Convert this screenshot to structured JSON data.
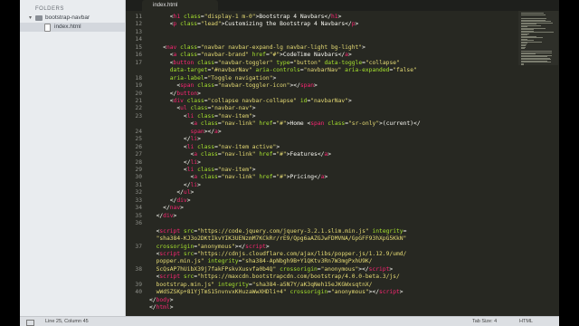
{
  "sidebar": {
    "title": "FOLDERS",
    "folder": "bootstrap-navbar",
    "file": "index.html"
  },
  "tab": {
    "label": "index.html"
  },
  "status": {
    "position": "Line 25, Column 45",
    "tab_size": "Tab Size: 4",
    "syntax": "HTML"
  },
  "line_numbers": [
    "11",
    "12",
    "13",
    "14",
    "15",
    "16",
    "17",
    "",
    "18",
    "19",
    "20",
    "21",
    "22",
    "23",
    "",
    "24",
    "25",
    "26",
    "27",
    "28",
    "29",
    "30",
    "31",
    "32",
    "33",
    "34",
    "35",
    "36",
    "",
    "",
    "37",
    "",
    "",
    "38",
    "",
    "39",
    "40"
  ],
  "code_lines": [
    [
      [
        "pl",
        "      <"
      ],
      [
        "tg",
        "h1"
      ],
      [
        "pl",
        " "
      ],
      [
        "at",
        "class"
      ],
      [
        "pl",
        "="
      ],
      [
        "st",
        "\"display-1 m-0\""
      ],
      [
        "pl",
        ">Bootstrap 4 Navbars</"
      ],
      [
        "tg",
        "h1"
      ],
      [
        "pl",
        ">"
      ]
    ],
    [
      [
        "pl",
        "      <"
      ],
      [
        "tg",
        "p"
      ],
      [
        "pl",
        " "
      ],
      [
        "at",
        "class"
      ],
      [
        "pl",
        "="
      ],
      [
        "st",
        "\"lead\""
      ],
      [
        "pl",
        ">Customizing the Bootstrap 4 Navbars</"
      ],
      [
        "tg",
        "p"
      ],
      [
        "pl",
        ">"
      ]
    ],
    [],
    [],
    [
      [
        "pl",
        "    <"
      ],
      [
        "tg",
        "nav"
      ],
      [
        "pl",
        " "
      ],
      [
        "at",
        "class"
      ],
      [
        "pl",
        "="
      ],
      [
        "st",
        "\"navbar navbar-expand-lg navbar-light bg-light\""
      ],
      [
        "pl",
        ">"
      ]
    ],
    [
      [
        "pl",
        "      <"
      ],
      [
        "tg",
        "a"
      ],
      [
        "pl",
        " "
      ],
      [
        "at",
        "class"
      ],
      [
        "pl",
        "="
      ],
      [
        "st",
        "\"navbar-brand\""
      ],
      [
        "pl",
        " "
      ],
      [
        "at",
        "href"
      ],
      [
        "pl",
        "="
      ],
      [
        "st",
        "\"#\""
      ],
      [
        "pl",
        ">CodeTime Navbars</"
      ],
      [
        "tg",
        "a"
      ],
      [
        "pl",
        ">"
      ]
    ],
    [
      [
        "pl",
        "      <"
      ],
      [
        "tg",
        "button"
      ],
      [
        "pl",
        " "
      ],
      [
        "at",
        "class"
      ],
      [
        "pl",
        "="
      ],
      [
        "st",
        "\"navbar-toggler\""
      ],
      [
        "pl",
        " "
      ],
      [
        "at",
        "type"
      ],
      [
        "pl",
        "="
      ],
      [
        "st",
        "\"button\""
      ],
      [
        "pl",
        " "
      ],
      [
        "at",
        "data-toggle"
      ],
      [
        "pl",
        "="
      ],
      [
        "st",
        "\"collapse\""
      ]
    ],
    [
      [
        "pl",
        "      "
      ],
      [
        "at",
        "data-target"
      ],
      [
        "pl",
        "="
      ],
      [
        "st",
        "\"#navbarNav\""
      ],
      [
        "pl",
        " "
      ],
      [
        "at",
        "aria-controls"
      ],
      [
        "pl",
        "="
      ],
      [
        "st",
        "\"navbarNav\""
      ],
      [
        "pl",
        " "
      ],
      [
        "at",
        "aria-expanded"
      ],
      [
        "pl",
        "="
      ],
      [
        "st",
        "\"false\""
      ]
    ],
    [
      [
        "pl",
        "      "
      ],
      [
        "at",
        "aria-label"
      ],
      [
        "pl",
        "="
      ],
      [
        "st",
        "\"Toggle navigation\""
      ],
      [
        "pl",
        ">"
      ]
    ],
    [
      [
        "pl",
        "        <"
      ],
      [
        "tg",
        "span"
      ],
      [
        "pl",
        " "
      ],
      [
        "at",
        "class"
      ],
      [
        "pl",
        "="
      ],
      [
        "st",
        "\"navbar-toggler-icon\""
      ],
      [
        "pl",
        "></"
      ],
      [
        "tg",
        "span"
      ],
      [
        "pl",
        ">"
      ]
    ],
    [
      [
        "pl",
        "      </"
      ],
      [
        "tg",
        "button"
      ],
      [
        "pl",
        ">"
      ]
    ],
    [
      [
        "pl",
        "      <"
      ],
      [
        "tg",
        "div"
      ],
      [
        "pl",
        " "
      ],
      [
        "at",
        "class"
      ],
      [
        "pl",
        "="
      ],
      [
        "st",
        "\"collapse navbar-collapse\""
      ],
      [
        "pl",
        " "
      ],
      [
        "at",
        "id"
      ],
      [
        "pl",
        "="
      ],
      [
        "st",
        "\"navbarNav\""
      ],
      [
        "pl",
        ">"
      ]
    ],
    [
      [
        "pl",
        "        <"
      ],
      [
        "tg",
        "ul"
      ],
      [
        "pl",
        " "
      ],
      [
        "at",
        "class"
      ],
      [
        "pl",
        "="
      ],
      [
        "st",
        "\"navbar-nav\""
      ],
      [
        "pl",
        ">"
      ]
    ],
    [
      [
        "pl",
        "          <"
      ],
      [
        "tg",
        "li"
      ],
      [
        "pl",
        " "
      ],
      [
        "at",
        "class"
      ],
      [
        "pl",
        "="
      ],
      [
        "st",
        "\"nav-item\""
      ],
      [
        "pl",
        ">"
      ]
    ],
    [
      [
        "pl",
        "            <"
      ],
      [
        "tg",
        "a"
      ],
      [
        "pl",
        " "
      ],
      [
        "at",
        "class"
      ],
      [
        "pl",
        "="
      ],
      [
        "st",
        "\"nav-link\""
      ],
      [
        "pl",
        " "
      ],
      [
        "at",
        "href"
      ],
      [
        "pl",
        "="
      ],
      [
        "st",
        "\"#\""
      ],
      [
        "pl",
        ">Home <"
      ],
      [
        "tg",
        "span"
      ],
      [
        "pl",
        " "
      ],
      [
        "at",
        "class"
      ],
      [
        "pl",
        "="
      ],
      [
        "st",
        "\"sr-only\""
      ],
      [
        "pl",
        ">(current)</"
      ]
    ],
    [
      [
        "pl",
        "            "
      ],
      [
        "tg",
        "span"
      ],
      [
        "pl",
        "></"
      ],
      [
        "tg",
        "a"
      ],
      [
        "pl",
        ">"
      ]
    ],
    [
      [
        "pl",
        "          </"
      ],
      [
        "tg",
        "li"
      ],
      [
        "pl",
        ">"
      ]
    ],
    [
      [
        "pl",
        "          <"
      ],
      [
        "tg",
        "li"
      ],
      [
        "pl",
        " "
      ],
      [
        "at",
        "class"
      ],
      [
        "pl",
        "="
      ],
      [
        "st",
        "\"nav-item active\""
      ],
      [
        "pl",
        ">"
      ]
    ],
    [
      [
        "pl",
        "            <"
      ],
      [
        "tg",
        "a"
      ],
      [
        "pl",
        " "
      ],
      [
        "at",
        "class"
      ],
      [
        "pl",
        "="
      ],
      [
        "st",
        "\"nav-link\""
      ],
      [
        "pl",
        " "
      ],
      [
        "at",
        "href"
      ],
      [
        "pl",
        "="
      ],
      [
        "st",
        "\"#\""
      ],
      [
        "pl",
        ">Features</"
      ],
      [
        "tg",
        "a"
      ],
      [
        "pl",
        ">"
      ]
    ],
    [
      [
        "pl",
        "          </"
      ],
      [
        "tg",
        "li"
      ],
      [
        "pl",
        ">"
      ]
    ],
    [
      [
        "pl",
        "          <"
      ],
      [
        "tg",
        "li"
      ],
      [
        "pl",
        " "
      ],
      [
        "at",
        "class"
      ],
      [
        "pl",
        "="
      ],
      [
        "st",
        "\"nav-item\""
      ],
      [
        "pl",
        ">"
      ]
    ],
    [
      [
        "pl",
        "            <"
      ],
      [
        "tg",
        "a"
      ],
      [
        "pl",
        " "
      ],
      [
        "at",
        "class"
      ],
      [
        "pl",
        "="
      ],
      [
        "st",
        "\"nav-link\""
      ],
      [
        "pl",
        " "
      ],
      [
        "at",
        "href"
      ],
      [
        "pl",
        "="
      ],
      [
        "st",
        "\"#\""
      ],
      [
        "pl",
        ">Pricing</"
      ],
      [
        "tg",
        "a"
      ],
      [
        "pl",
        ">"
      ]
    ],
    [
      [
        "pl",
        "          </"
      ],
      [
        "tg",
        "li"
      ],
      [
        "pl",
        ">"
      ]
    ],
    [
      [
        "pl",
        "        </"
      ],
      [
        "tg",
        "ul"
      ],
      [
        "pl",
        ">"
      ]
    ],
    [
      [
        "pl",
        "      </"
      ],
      [
        "tg",
        "div"
      ],
      [
        "pl",
        ">"
      ]
    ],
    [
      [
        "pl",
        "    </"
      ],
      [
        "tg",
        "nav"
      ],
      [
        "pl",
        ">"
      ]
    ],
    [
      [
        "pl",
        "  </"
      ],
      [
        "tg",
        "div"
      ],
      [
        "pl",
        ">"
      ]
    ],
    [],
    [
      [
        "pl",
        "  <"
      ],
      [
        "tg",
        "script"
      ],
      [
        "pl",
        " "
      ],
      [
        "at",
        "src"
      ],
      [
        "pl",
        "="
      ],
      [
        "st",
        "\"https://code.jquery.com/jquery-3.2.1.slim.min.js\""
      ],
      [
        "pl",
        " "
      ],
      [
        "at",
        "integrity"
      ],
      [
        "pl",
        "="
      ]
    ],
    [
      [
        "st",
        "  \"sha384-KJ3o2DKtIkvYIK3UENzmM7KCkRr/rE9/Qpg6aAZGJwFDMVNA/GpGFF93hXpG5KkN\""
      ]
    ],
    [
      [
        "pl",
        "  "
      ],
      [
        "at",
        "crossorigin"
      ],
      [
        "pl",
        "="
      ],
      [
        "st",
        "\"anonymous\""
      ],
      [
        "pl",
        "></"
      ],
      [
        "tg",
        "script"
      ],
      [
        "pl",
        ">"
      ]
    ],
    [
      [
        "pl",
        "  <"
      ],
      [
        "tg",
        "script"
      ],
      [
        "pl",
        " "
      ],
      [
        "at",
        "src"
      ],
      [
        "pl",
        "="
      ],
      [
        "st",
        "\"https://cdnjs.cloudflare.com/ajax/libs/popper.js/1.12.9/umd/"
      ]
    ],
    [
      [
        "st",
        "  popper.min.js\""
      ],
      [
        "pl",
        " "
      ],
      [
        "at",
        "integrity"
      ],
      [
        "pl",
        "="
      ],
      [
        "st",
        "\"sha384-ApNbgh9B+Y1QKtv3Rn7W3mgPxhU9K/"
      ]
    ],
    [
      [
        "st",
        "  ScQsAP7hUibX39j7fakFPskvXusvfa0b4Q\""
      ],
      [
        "pl",
        " "
      ],
      [
        "at",
        "crossorigin"
      ],
      [
        "pl",
        "="
      ],
      [
        "st",
        "\"anonymous\""
      ],
      [
        "pl",
        "></"
      ],
      [
        "tg",
        "script"
      ],
      [
        "pl",
        ">"
      ]
    ],
    [
      [
        "pl",
        "  <"
      ],
      [
        "tg",
        "script"
      ],
      [
        "pl",
        " "
      ],
      [
        "at",
        "src"
      ],
      [
        "pl",
        "="
      ],
      [
        "st",
        "\"https://maxcdn.bootstrapcdn.com/bootstrap/4.0.0-beta.3/js/"
      ]
    ],
    [
      [
        "st",
        "  bootstrap.min.js\""
      ],
      [
        "pl",
        " "
      ],
      [
        "at",
        "integrity"
      ],
      [
        "pl",
        "="
      ],
      [
        "st",
        "\"sha384-a5N7Y/aK3qNeh15eJKGWxsqtnX/"
      ]
    ],
    [
      [
        "st",
        "  wWdSZSKp+81YjTmS15nvnvxKHuzaWwXHDli+4\""
      ],
      [
        "pl",
        " "
      ],
      [
        "at",
        "crossorigin"
      ],
      [
        "pl",
        "="
      ],
      [
        "st",
        "\"anonymous\""
      ],
      [
        "pl",
        "></"
      ],
      [
        "tg",
        "script"
      ],
      [
        "pl",
        ">"
      ]
    ],
    [
      [
        "pl",
        "</"
      ],
      [
        "tg",
        "body"
      ],
      [
        "pl",
        ">"
      ]
    ],
    [
      [
        "pl",
        "</"
      ],
      [
        "tg",
        "html"
      ],
      [
        "pl",
        ">"
      ]
    ]
  ],
  "colors": {
    "editor_bg": "#272822",
    "tag": "#f92672",
    "attr": "#a6e22e",
    "string": "#e6db74",
    "text": "#f8f8f2",
    "sidebar_bg": "#e9ecef"
  }
}
